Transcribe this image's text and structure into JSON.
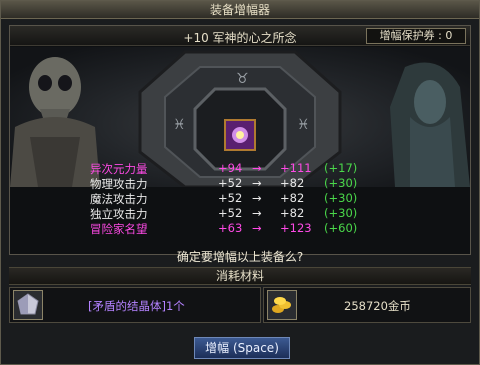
{
  "window": {
    "title": "装备增幅器"
  },
  "item": {
    "name": "+10 军神的心之所念"
  },
  "protection": {
    "label": "增幅保护券 : 0"
  },
  "stats": [
    {
      "label": "异次元力量",
      "from": "+94",
      "arrow": "→",
      "to": "+111",
      "delta": "(+17)",
      "color": "magenta"
    },
    {
      "label": "物理攻击力",
      "from": "+52",
      "arrow": "→",
      "to": "+82",
      "delta": "(+30)",
      "color": "white"
    },
    {
      "label": "魔法攻击力",
      "from": "+52",
      "arrow": "→",
      "to": "+82",
      "delta": "(+30)",
      "color": "white"
    },
    {
      "label": "独立攻击力",
      "from": "+52",
      "arrow": "→",
      "to": "+82",
      "delta": "(+30)",
      "color": "white"
    },
    {
      "label": "冒险家名望",
      "from": "+63",
      "arrow": "→",
      "to": "+123",
      "delta": "(+60)",
      "color": "magenta"
    }
  ],
  "confirm_text": "确定要增幅以上装备么?",
  "materials": {
    "header": "消耗材料",
    "crystal": {
      "text": "[矛盾的结晶体]1个",
      "icon": "crystal-icon"
    },
    "gold": {
      "text": "258720金币",
      "icon": "gold-coins-icon"
    }
  },
  "buttons": {
    "enhance": "增幅 (Space)"
  },
  "colors": {
    "magenta": "#ff4ae6",
    "white": "#e8e8e8",
    "green": "#4ad84a",
    "crystal_text": "#b482ff"
  }
}
